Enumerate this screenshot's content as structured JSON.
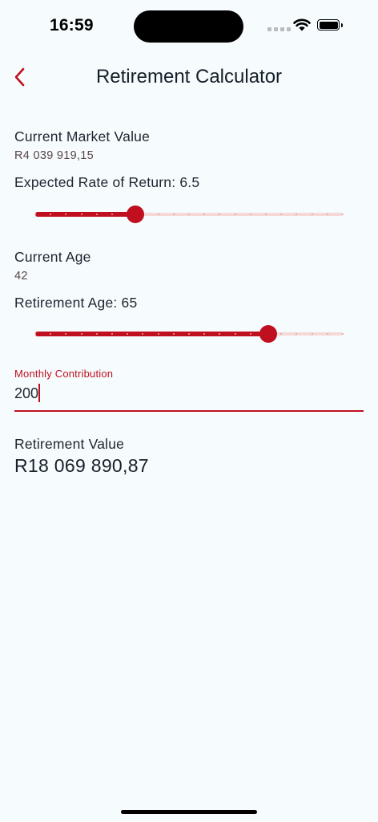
{
  "status_bar": {
    "time": "16:59"
  },
  "header": {
    "title": "Retirement Calculator"
  },
  "current_market_value": {
    "label": "Current Market Value",
    "value": "R4 039 919,15"
  },
  "rate_of_return": {
    "label": "Expected Rate of Return: 6.5",
    "value": 6.5,
    "min": 0,
    "max": 20,
    "divisions": 20
  },
  "current_age": {
    "label": "Current Age",
    "value": "42"
  },
  "retirement_age": {
    "label": "Retirement Age: 65",
    "value": 65,
    "min": 18,
    "max": 80,
    "divisions": 20
  },
  "monthly_contribution": {
    "label": "Monthly Contribution",
    "value": "200"
  },
  "retirement_value": {
    "label": "Retirement Value",
    "value": "R18 069 890,87"
  },
  "colors": {
    "accent": "#c0101f",
    "track_inactive": "#f6d8d6",
    "background": "#f6fbfd"
  }
}
